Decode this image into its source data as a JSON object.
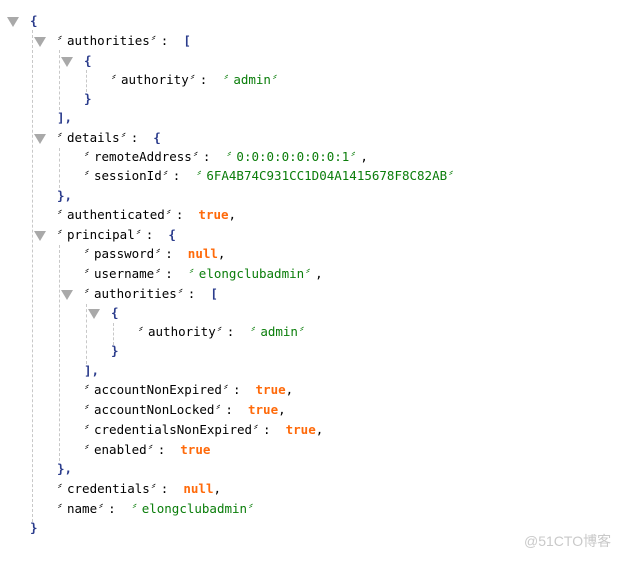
{
  "json_viewer": {
    "root_open": "{",
    "root_close": "}",
    "authorities": {
      "key": "authorities",
      "open": "[",
      "close": "],",
      "items": [
        {
          "open": "{",
          "close": "}",
          "key": "authority",
          "value": "admin"
        }
      ]
    },
    "details": {
      "key": "details",
      "open": "{",
      "close": "},",
      "remoteAddress": {
        "key": "remoteAddress",
        "value": "0:0:0:0:0:0:0:1"
      },
      "sessionId": {
        "key": "sessionId",
        "value": "6FA4B74C931CC1D04A1415678F8C82AB"
      }
    },
    "authenticated": {
      "key": "authenticated",
      "value": "true"
    },
    "principal": {
      "key": "principal",
      "open": "{",
      "close": "},",
      "password": {
        "key": "password",
        "value": "null"
      },
      "username": {
        "key": "username",
        "value": "elongclubadmin"
      },
      "authorities": {
        "key": "authorities",
        "open": "[",
        "close": "],",
        "items": [
          {
            "open": "{",
            "close": "}",
            "key": "authority",
            "value": "admin"
          }
        ]
      },
      "accountNonExpired": {
        "key": "accountNonExpired",
        "value": "true"
      },
      "accountNonLocked": {
        "key": "accountNonLocked",
        "value": "true"
      },
      "credentialsNonExpired": {
        "key": "credentialsNonExpired",
        "value": "true"
      },
      "enabled": {
        "key": "enabled",
        "value": "true"
      }
    },
    "credentials": {
      "key": "credentials",
      "value": "null"
    },
    "name": {
      "key": "name",
      "value": "elongclubadmin"
    }
  },
  "punctuation": {
    "quote": "〞",
    "colon": ":  ",
    "comma": ","
  },
  "watermark": "@51CTO博客",
  "colors": {
    "string": "#0a7d0a",
    "keyword": "#ff6a0a",
    "bracket": "#2b3c8c",
    "toggle": "#a9a9a9",
    "guide": "#c8c8c8"
  }
}
